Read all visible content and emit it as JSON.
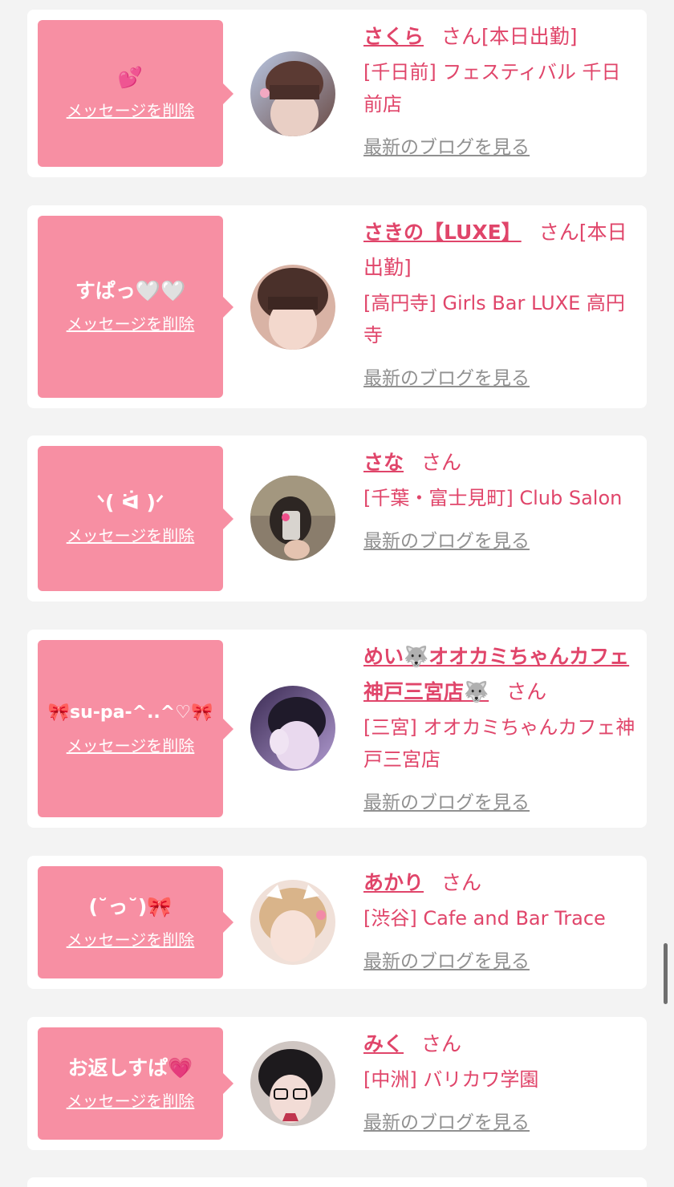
{
  "accent_color": "#e0456a",
  "bubble_color": "#f78fa3",
  "items": [
    {
      "message": "💕",
      "delete_label": "メッセージを削除",
      "name": "さくら",
      "san": "さん[本日出勤]",
      "shop": "[千日前] フェスティバル 千日前店",
      "blog": "最新のブログを見る"
    },
    {
      "message": "すぱっ🤍🤍",
      "delete_label": "メッセージを削除",
      "name": "さきの【LUXE】",
      "san": "さん[本日出勤]",
      "shop": "[高円寺] Girls Bar LUXE 高円寺",
      "blog": "最新のブログを見る"
    },
    {
      "message": "ᐠ( ᐛ )ᐟ",
      "delete_label": "メッセージを削除",
      "name": "さな",
      "san": "さん",
      "shop": "[千葉・富士見町] Club Salon",
      "blog": "最新のブログを見る"
    },
    {
      "message": "🎀su-pa-^..^♡🎀",
      "delete_label": "メッセージを削除",
      "name": "めい🐺オオカミちゃんカフェ神戸三宮店🐺",
      "san": "さん",
      "shop": "[三宮] オオカミちゃんカフェ神戸三宮店",
      "blog": "最新のブログを見る"
    },
    {
      "message": "(˘っ˘)🎀",
      "delete_label": "メッセージを削除",
      "name": "あかり",
      "san": "さん",
      "shop": "[渋谷] Cafe and Bar Trace",
      "blog": "最新のブログを見る"
    },
    {
      "message": "お返しすぱ💗",
      "delete_label": "メッセージを削除",
      "name": "みく",
      "san": "さん",
      "shop": "[中洲] バリカワ学園",
      "blog": "最新のブログを見る"
    }
  ]
}
